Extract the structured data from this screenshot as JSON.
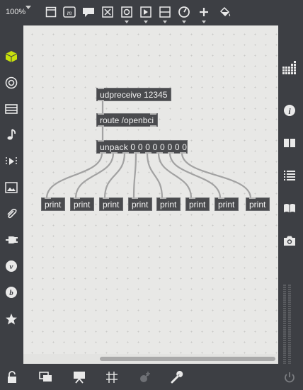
{
  "toolbar": {
    "zoom": "100%",
    "icons": [
      "presentation-mode-icon",
      "new-object-icon",
      "comment-icon",
      "toggle-icon",
      "bang-icon",
      "message-icon",
      "slider-icon",
      "dial-icon",
      "add-icon",
      "paint-bucket-icon"
    ]
  },
  "left_sidebar": {
    "icons": [
      "cube-icon",
      "target-icon",
      "browser-icon",
      "music-note-icon",
      "media-icon",
      "image-icon",
      "paperclip-icon",
      "plug-icon",
      "vimeo-icon",
      "bandcamp-icon",
      "star-icon"
    ]
  },
  "right_sidebar": {
    "icons": [
      "grid-icon",
      "info-icon",
      "book-icon",
      "list-icon",
      "reference-icon",
      "camera-icon"
    ]
  },
  "bottom_bar": {
    "icons": [
      "lock-icon",
      "presentation-icon",
      "inspector-icon",
      "grid-icon",
      "debug-icon",
      "wrench-icon",
      "power-icon"
    ]
  },
  "patch": {
    "udpreceive": "udpreceive 12345",
    "route": "route /openbci",
    "unpack": "unpack 0 0 0 0 0 0 0 0",
    "prints": [
      "print",
      "print",
      "print",
      "print",
      "print",
      "print",
      "print",
      "print"
    ]
  },
  "colors": {
    "chrome": "#3d3f44",
    "canvas": "#e8e8e6",
    "object": "#4a4b4e",
    "accent": "#c7e00c"
  }
}
